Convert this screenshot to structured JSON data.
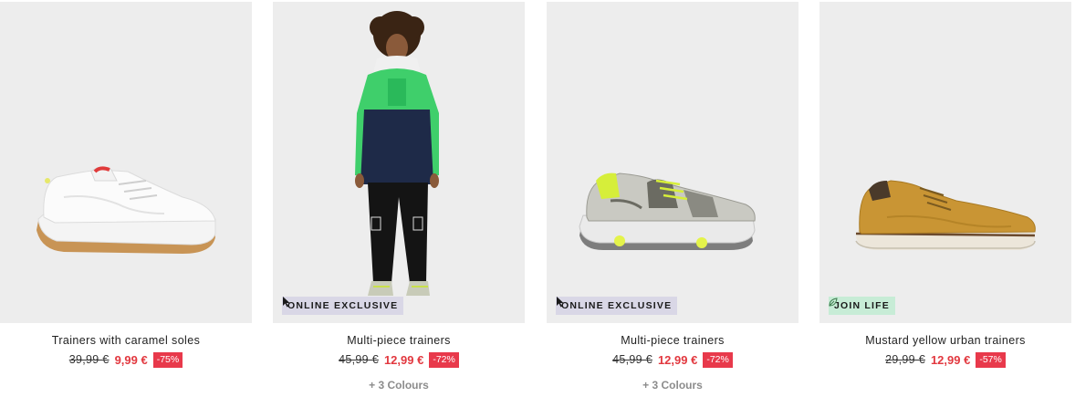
{
  "products": [
    {
      "name": "Trainers with caramel soles",
      "old_price": "39,99 €",
      "price": "9,99 €",
      "discount": "-75%",
      "badge": "",
      "colours": ""
    },
    {
      "name": "Multi-piece trainers",
      "old_price": "45,99 €",
      "price": "12,99 €",
      "discount": "-72%",
      "badge": "ONLINE EXCLUSIVE",
      "colours": "+ 3 Colours"
    },
    {
      "name": "Multi-piece trainers",
      "old_price": "45,99 €",
      "price": "12,99 €",
      "discount": "-72%",
      "badge": "ONLINE EXCLUSIVE",
      "colours": "+ 3 Colours"
    },
    {
      "name": "Mustard yellow urban trainers",
      "old_price": "29,99 €",
      "price": "12,99 €",
      "discount": "-57%",
      "badge": "JOIN LIFE",
      "colours": ""
    }
  ],
  "colors": {
    "image_bg": "#ededed",
    "price_red": "#e2383f",
    "discount_bg": "#e8394b",
    "online_badge_bg": "#d9d7e6",
    "joinlife_badge_bg": "#c7ecd6"
  },
  "icons": {
    "online_badge": "cursor-arrow-icon",
    "joinlife_badge": "leaf-icon"
  }
}
